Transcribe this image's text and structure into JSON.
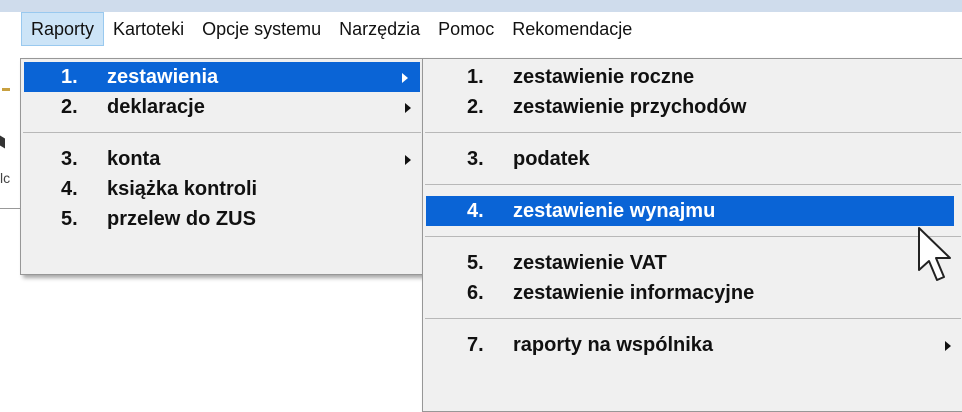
{
  "menubar": {
    "items": [
      "Raporty",
      "Kartoteki",
      "Opcje systemu",
      "Narzędzia",
      "Pomoc",
      "Rekomendacje"
    ]
  },
  "background": {
    "fragment_text": "lc"
  },
  "raporty_menu": {
    "items": [
      {
        "num": "1.",
        "label": "zestawienia",
        "submenu": true,
        "highlighted": true
      },
      {
        "num": "2.",
        "label": "deklaracje",
        "submenu": true
      },
      {
        "num": "3.",
        "label": "konta",
        "submenu": true
      },
      {
        "num": "4.",
        "label": "książka kontroli",
        "submenu": false
      },
      {
        "num": "5.",
        "label": "przelew do ZUS",
        "submenu": false
      }
    ]
  },
  "zestawienia_menu": {
    "items": [
      {
        "num": "1.",
        "label": "zestawienie roczne"
      },
      {
        "num": "2.",
        "label": "zestawienie przychodów"
      },
      {
        "num": "3.",
        "label": "podatek"
      },
      {
        "num": "4.",
        "label": "zestawienie wynajmu",
        "highlighted": true
      },
      {
        "num": "5.",
        "label": "zestawienie VAT"
      },
      {
        "num": "6.",
        "label": "zestawienie informacyjne"
      },
      {
        "num": "7.",
        "label": "raporty na wspólnika",
        "submenu": true
      }
    ]
  },
  "colors": {
    "highlight": "#0a64d6",
    "menu_bg": "#f0f0f0",
    "active_menubar": "#cce4f7"
  },
  "icons": {
    "cursor": "mouse-pointer-icon",
    "submenu_arrow": "chevron-right-icon"
  }
}
